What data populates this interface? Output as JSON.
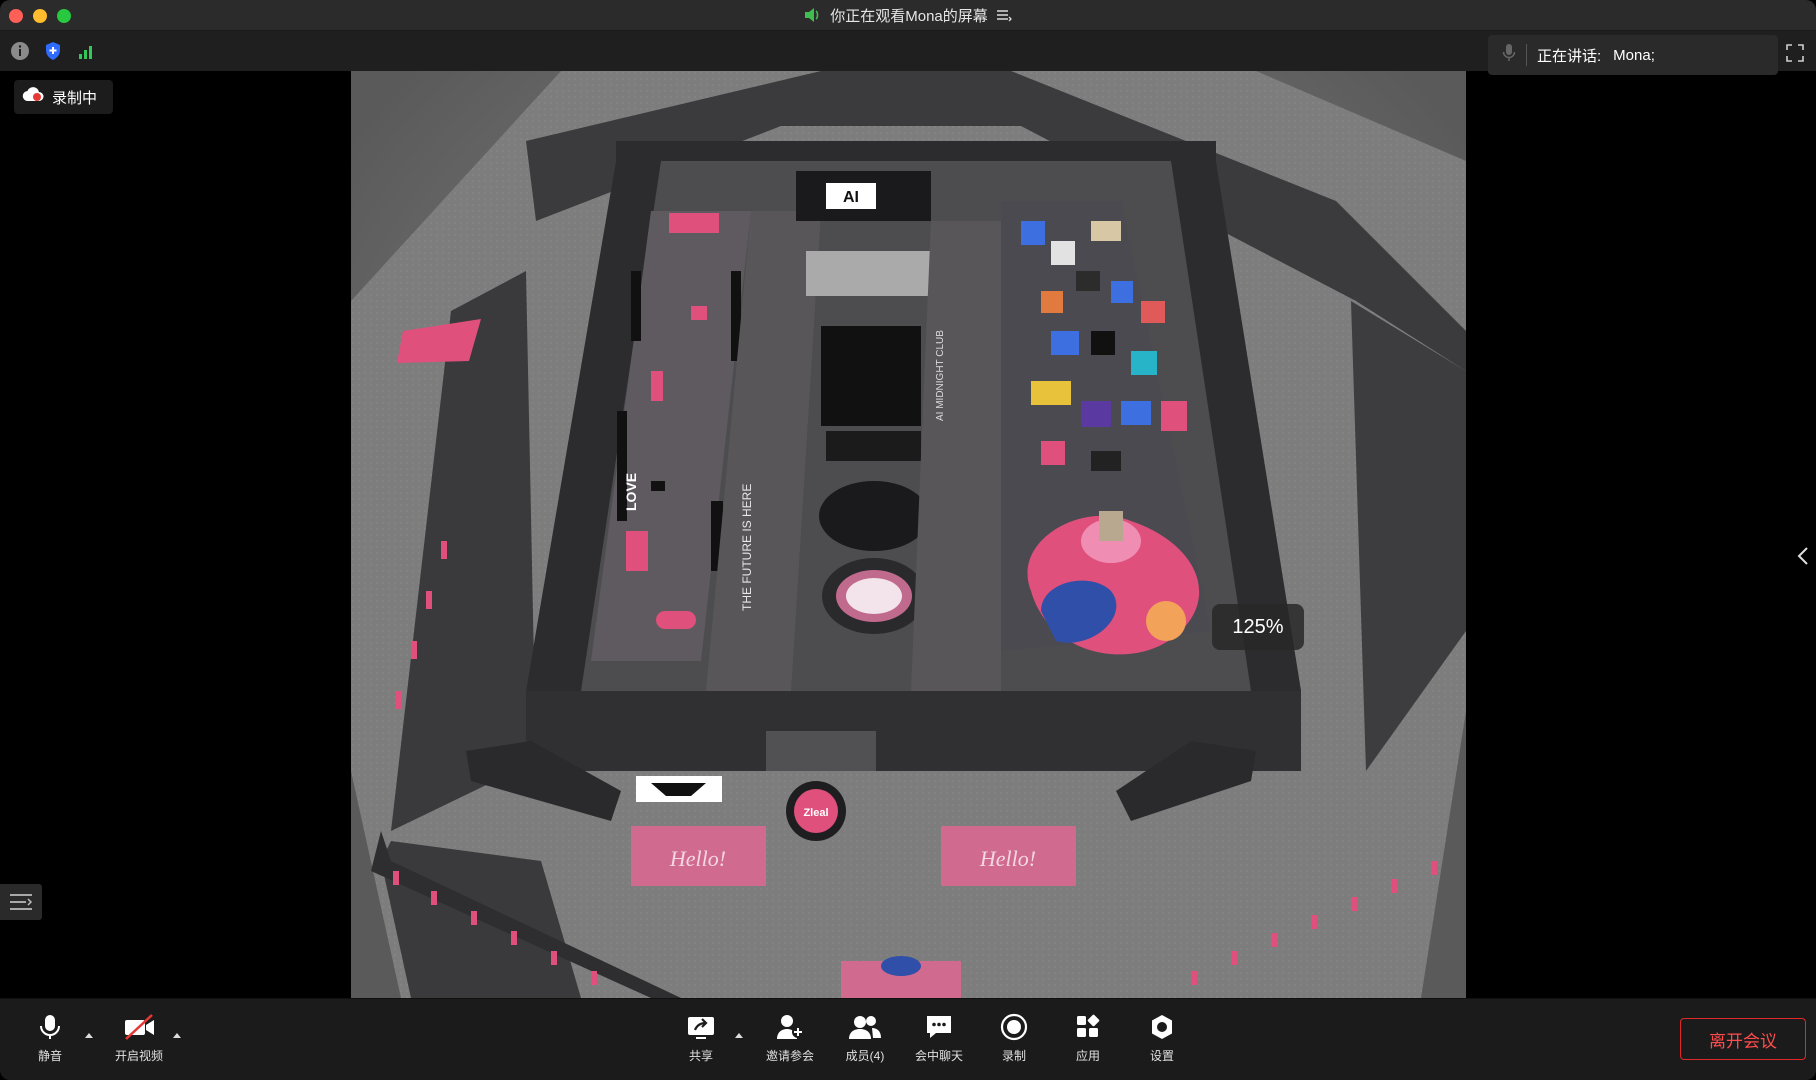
{
  "window": {
    "title": "你正在观看Mona的屏幕"
  },
  "speaker": {
    "label": "正在讲话:",
    "name": "Mona;"
  },
  "recording": {
    "label": "录制中"
  },
  "shared_screen": {
    "zoom": "125%",
    "signs": {
      "ai_logo": "AI",
      "hello_left": "Hello!",
      "hello_right": "Hello!",
      "future_banner": "THE FUTURE IS HERE",
      "love_text": "LOVE",
      "midnight_club": "AI MIDNIGHT CLUB",
      "zleal_logo": "Zleal"
    }
  },
  "controls": {
    "mute": "静音",
    "video": "开启视频",
    "share": "共享",
    "invite": "邀请参会",
    "participants": "成员(4)",
    "chat": "会中聊天",
    "record": "录制",
    "apps": "应用",
    "settings": "设置",
    "leave": "离开会议"
  },
  "colors": {
    "leave_red": "#e02828",
    "accent_pink": "#e0507c",
    "signal_green": "#34c759",
    "shield_blue": "#2f6bff"
  }
}
